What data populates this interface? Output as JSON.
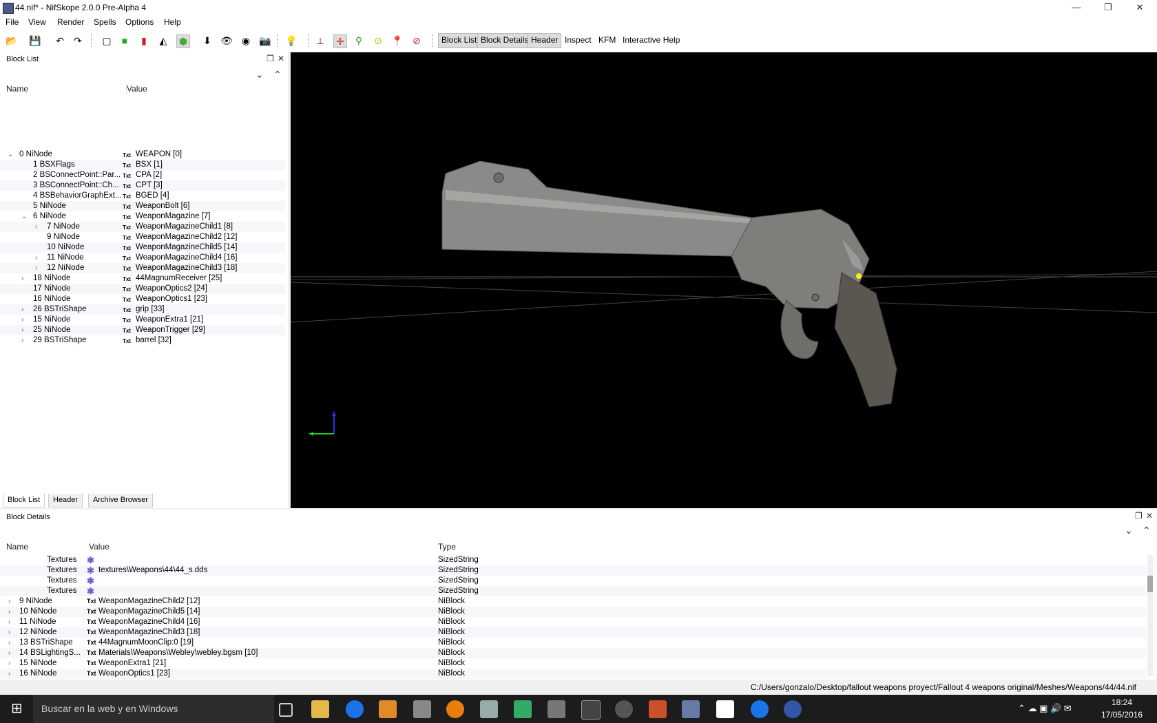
{
  "window": {
    "title": "44.nif* - NifSkope 2.0.0 Pre-Alpha 4",
    "controls": {
      "minimize": "—",
      "restore": "❐",
      "close": "✕"
    }
  },
  "menu": [
    "File",
    "View",
    "Render",
    "Spells",
    "Options",
    "Help"
  ],
  "toolbar": {
    "buttons": [
      "Block List",
      "Block Details",
      "Header",
      "Inspect",
      "KFM",
      "Interactive Help"
    ]
  },
  "block_list": {
    "title": "Block List",
    "columns": {
      "name": "Name",
      "value": "Value"
    },
    "rows": [
      {
        "arrow": "⌄",
        "indent": 0,
        "name": "0 NiNode",
        "value": "WEAPON [0]"
      },
      {
        "arrow": "",
        "indent": 1,
        "name": "1 BSXFlags",
        "value": "BSX [1]"
      },
      {
        "arrow": "",
        "indent": 1,
        "name": "2 BSConnectPoint::Par...",
        "value": "CPA [2]"
      },
      {
        "arrow": "",
        "indent": 1,
        "name": "3 BSConnectPoint::Ch...",
        "value": "CPT [3]"
      },
      {
        "arrow": "",
        "indent": 1,
        "name": "4 BSBehaviorGraphExt...",
        "value": "BGED [4]"
      },
      {
        "arrow": "",
        "indent": 1,
        "name": "5 NiNode",
        "value": "WeaponBolt [6]"
      },
      {
        "arrow": "⌄",
        "indent": 1,
        "name": "6 NiNode",
        "value": "WeaponMagazine [7]"
      },
      {
        "arrow": "›",
        "indent": 2,
        "name": "7 NiNode",
        "value": "WeaponMagazineChild1 [8]"
      },
      {
        "arrow": "",
        "indent": 2,
        "name": "9 NiNode",
        "value": "WeaponMagazineChild2 [12]"
      },
      {
        "arrow": "",
        "indent": 2,
        "name": "10 NiNode",
        "value": "WeaponMagazineChild5 [14]"
      },
      {
        "arrow": "›",
        "indent": 2,
        "name": "11 NiNode",
        "value": "WeaponMagazineChild4 [16]"
      },
      {
        "arrow": "›",
        "indent": 2,
        "name": "12 NiNode",
        "value": "WeaponMagazineChild3 [18]"
      },
      {
        "arrow": "›",
        "indent": 1,
        "name": "18 NiNode",
        "value": "44MagnumReceiver [25]"
      },
      {
        "arrow": "",
        "indent": 1,
        "name": "17 NiNode",
        "value": "WeaponOptics2 [24]"
      },
      {
        "arrow": "",
        "indent": 1,
        "name": "16 NiNode",
        "value": "WeaponOptics1 [23]"
      },
      {
        "arrow": "›",
        "indent": 1,
        "name": "26 BSTriShape",
        "value": "grip [33]"
      },
      {
        "arrow": "›",
        "indent": 1,
        "name": "15 NiNode",
        "value": "WeaponExtra1 [21]"
      },
      {
        "arrow": "›",
        "indent": 1,
        "name": "25 NiNode",
        "value": "WeaponTrigger [29]"
      },
      {
        "arrow": "›",
        "indent": 1,
        "name": "29 BSTriShape",
        "value": "barrel [32]"
      }
    ],
    "tabs": [
      "Block List",
      "Header",
      "Archive Browser"
    ]
  },
  "block_details": {
    "title": "Block Details",
    "columns": {
      "name": "Name",
      "value": "Value",
      "type": "Type"
    },
    "rows": [
      {
        "arrow": "",
        "icon": "✱",
        "name": "Textures",
        "value": "",
        "type": "SizedString"
      },
      {
        "arrow": "",
        "icon": "✱",
        "name": "Textures",
        "value": "textures\\Weapons\\44\\44_s.dds",
        "type": "SizedString"
      },
      {
        "arrow": "",
        "icon": "✱",
        "name": "Textures",
        "value": "",
        "type": "SizedString"
      },
      {
        "arrow": "",
        "icon": "✱",
        "name": "Textures",
        "value": "",
        "type": "SizedString"
      },
      {
        "arrow": "›",
        "icon": "Txt",
        "name": "9 NiNode",
        "value": "WeaponMagazineChild2 [12]",
        "type": "NiBlock"
      },
      {
        "arrow": "›",
        "icon": "Txt",
        "name": "10 NiNode",
        "value": "WeaponMagazineChild5 [14]",
        "type": "NiBlock"
      },
      {
        "arrow": "›",
        "icon": "Txt",
        "name": "11 NiNode",
        "value": "WeaponMagazineChild4 [16]",
        "type": "NiBlock"
      },
      {
        "arrow": "›",
        "icon": "Txt",
        "name": "12 NiNode",
        "value": "WeaponMagazineChild3 [18]",
        "type": "NiBlock"
      },
      {
        "arrow": "›",
        "icon": "Txt",
        "name": "13 BSTriShape",
        "value": "44MagnumMoonClip:0 [19]",
        "type": "NiBlock"
      },
      {
        "arrow": "›",
        "icon": "Txt",
        "name": "14 BSLightingS...",
        "value": "Materials\\Weapons\\Webley\\webley.bgsm [10]",
        "type": "NiBlock"
      },
      {
        "arrow": "›",
        "icon": "Txt",
        "name": "15 NiNode",
        "value": "WeaponExtra1 [21]",
        "type": "NiBlock"
      },
      {
        "arrow": "›",
        "icon": "Txt",
        "name": "16 NiNode",
        "value": "WeaponOptics1 [23]",
        "type": "NiBlock"
      }
    ]
  },
  "status": {
    "path": "C:/Users/gonzalo/Desktop/fallout weapons proyect/Fallout 4 weapons original/Meshes/Weapons/44/44.nif"
  },
  "taskbar": {
    "search_placeholder": "Buscar en la web y en Windows",
    "time": "18:24",
    "date": "17/05/2016"
  },
  "colors": {
    "viewport_bg": "#000000",
    "taskbar_bg": "#1c1c1c",
    "axis_y": "#2233ff",
    "axis_x": "#22cc22",
    "selection_dot": "#ffee00"
  }
}
